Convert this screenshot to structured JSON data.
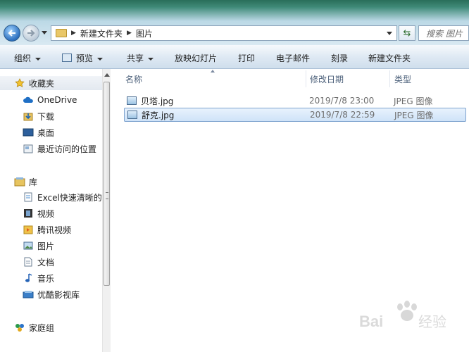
{
  "address_bar": {
    "crumbs": [
      "新建文件夹",
      "图片"
    ],
    "search_placeholder": "搜索 图片"
  },
  "toolbar": {
    "organize": "组织",
    "preview": "预览",
    "share": "共享",
    "slideshow": "放映幻灯片",
    "print": "打印",
    "email": "电子邮件",
    "burn": "刻录",
    "new_folder": "新建文件夹"
  },
  "nav": {
    "favorites": "收藏夹",
    "fav_items": [
      "OneDrive",
      "下载",
      "桌面",
      "最近访问的位置"
    ],
    "libraries": "库",
    "lib_items": [
      "Excel快速清晰的",
      "视频",
      "腾讯视频",
      "图片",
      "文档",
      "音乐",
      "优酷影视库"
    ],
    "homegroup": "家庭组"
  },
  "columns": {
    "name": "名称",
    "modified": "修改日期",
    "type": "类型"
  },
  "files": [
    {
      "name": "贝塔.jpg",
      "modified": "2019/7/8 23:00",
      "type": "JPEG 图像"
    },
    {
      "name": "舒克.jpg",
      "modified": "2019/7/8 22:59",
      "type": "JPEG 图像"
    }
  ],
  "watermark": {
    "text": "Bai 经验"
  },
  "colors": {
    "selection_border": "#7da2ce",
    "selection_fill": "#cfe3f8",
    "toolbar_bg": "#dde8f3"
  }
}
